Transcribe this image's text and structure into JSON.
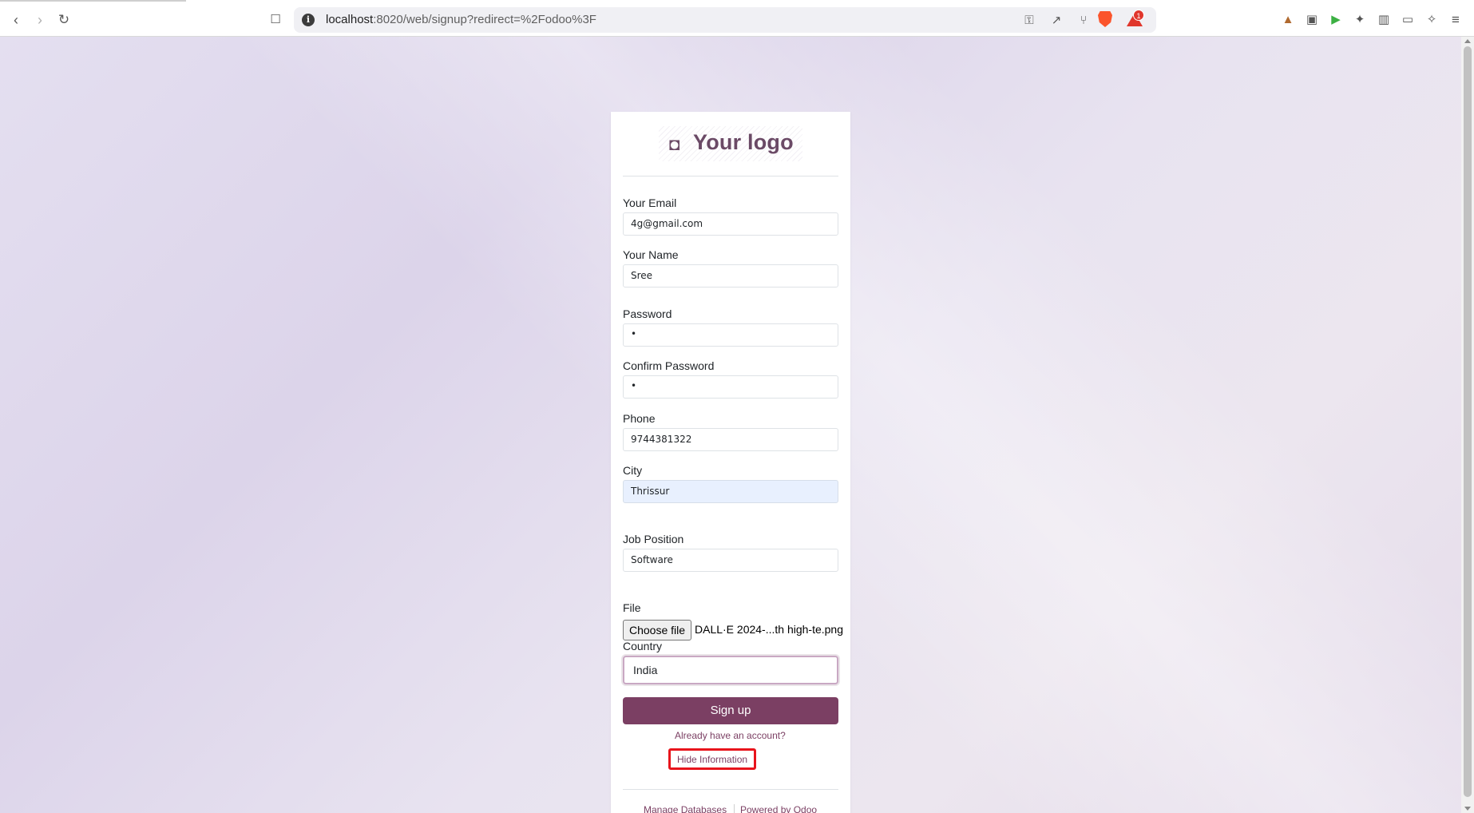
{
  "browser": {
    "url_host": "localhost",
    "url_rest": ":8020/web/signup?redirect=%2Fodoo%3F",
    "rewards_badge": "1"
  },
  "logo": {
    "text": "Your logo"
  },
  "form": {
    "email_label": "Your Email",
    "email_value": "4g@gmail.com",
    "name_label": "Your Name",
    "name_value": "Sree",
    "password_label": "Password",
    "password_value": "•",
    "confirm_label": "Confirm Password",
    "confirm_value": "•",
    "phone_label": "Phone",
    "phone_value": "9744381322",
    "city_label": "City",
    "city_value": "Thrissur",
    "job_label": "Job Position",
    "job_value": "Software",
    "file_label": "File",
    "file_button": "Choose file",
    "file_name": "DALL·E 2024-...th high-te.png",
    "country_label": "Country",
    "country_value": "India",
    "signup_button": "Sign up",
    "have_account": "Already have an account?",
    "hide_info": "Hide Information"
  },
  "footer": {
    "manage_db": "Manage Databases",
    "powered_by": "Powered by Odoo"
  }
}
